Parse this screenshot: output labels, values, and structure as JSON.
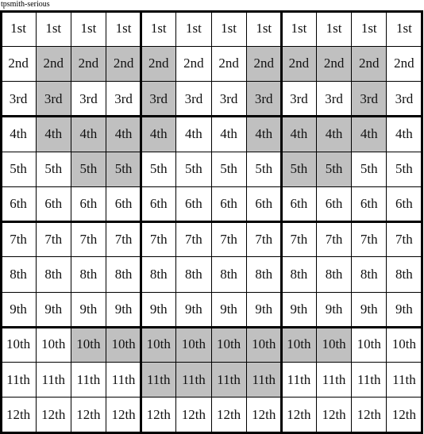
{
  "caption": "tpsmith-serious",
  "colors": {
    "shade": "#c0c0c0",
    "background": "#ffffff",
    "lines": "#000000"
  },
  "grid": {
    "rows": 12,
    "cols": 12,
    "thick_every_cols": 4,
    "thick_every_rows": 3,
    "row_labels": [
      "1st",
      "2nd",
      "3rd",
      "4th",
      "5th",
      "6th",
      "7th",
      "8th",
      "9th",
      "10th",
      "11th",
      "12th"
    ],
    "shaded": {
      "1": [
        1,
        2,
        3,
        4,
        7,
        8,
        9,
        10
      ],
      "2": [
        1,
        4,
        7,
        10
      ],
      "3": [
        1,
        2,
        3,
        4,
        7,
        8,
        9,
        10
      ],
      "4": [
        2,
        3,
        8,
        9
      ],
      "9": [
        2,
        3,
        4,
        5,
        6,
        7,
        8,
        9
      ],
      "10": [
        4,
        5,
        6,
        7
      ]
    }
  }
}
